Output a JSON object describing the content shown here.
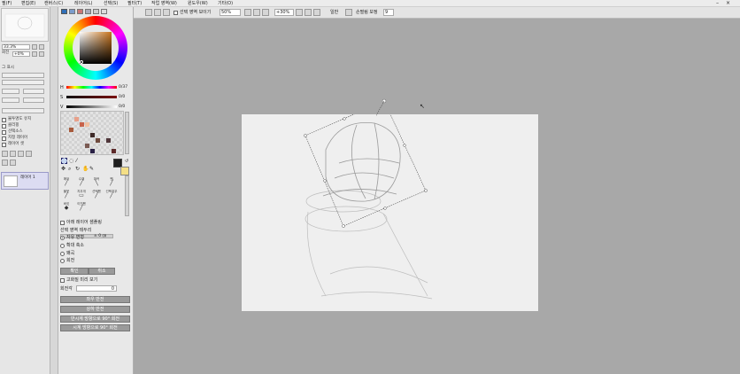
{
  "menubar": {
    "items": [
      "필(F)",
      "편집(E)",
      "캔버스(C)",
      "레이어(L)",
      "선택(S)",
      "필터(T)",
      "작업 영역(W)",
      "윈도우(W)",
      "기타(O)"
    ]
  },
  "toolbar": {
    "select_area_checkbox": "선택 영역 보이기",
    "zoom": "50%",
    "rotation": "+30%",
    "mode": "일반",
    "stabilizer_label": "손떨림 보정",
    "stabilizer_value": "9"
  },
  "left_panel": {
    "zoom_value": "33.3%",
    "rotation_value": "+0%",
    "rotate_label": "회전",
    "labels": [
      "그 표시",
      "레이어",
      "불투명도 유지",
      "클리핑",
      "선택소스",
      "지정 레이어",
      "레이어 셋"
    ],
    "layer_name": "레이어 1"
  },
  "color": {
    "h_label": "H",
    "h_value": "0/37",
    "s_label": "S",
    "s_value": "0/0",
    "v_label": "V",
    "v_value": "0/0",
    "fg_color": "#1e1e1e",
    "bg_color": "#f4df86"
  },
  "tools": {
    "palette_tools": [
      "선택",
      "올가미",
      "자동선택",
      "돋보기",
      "이동"
    ],
    "brushes": [
      "에어",
      "수채",
      "마커",
      "펜",
      "물붓",
      "지우개",
      "선택펜",
      "선택지우",
      "버킷",
      "이진펜"
    ],
    "tool_option_checkbox": "아래 레이어 샘플링",
    "select_area_label": "선택 영역 테두리",
    "scale_value": "± 0 ㎝",
    "transform_options": [
      "자유 변형",
      "확대 축소",
      "왜곡",
      "회전"
    ],
    "selected_option": 0,
    "ok_button": "확인",
    "cancel_button": "취소",
    "high_quality_check": "고화질 미리 보기",
    "angle_label": "회전각",
    "angle_value": "0",
    "flip_h_button": "좌우 반전",
    "flip_v_button": "상하 반전",
    "rotate_cw_button": "반시계 방향으로 90° 회전",
    "rotate_ccw_button": "시계 방향으로 90° 회전"
  }
}
